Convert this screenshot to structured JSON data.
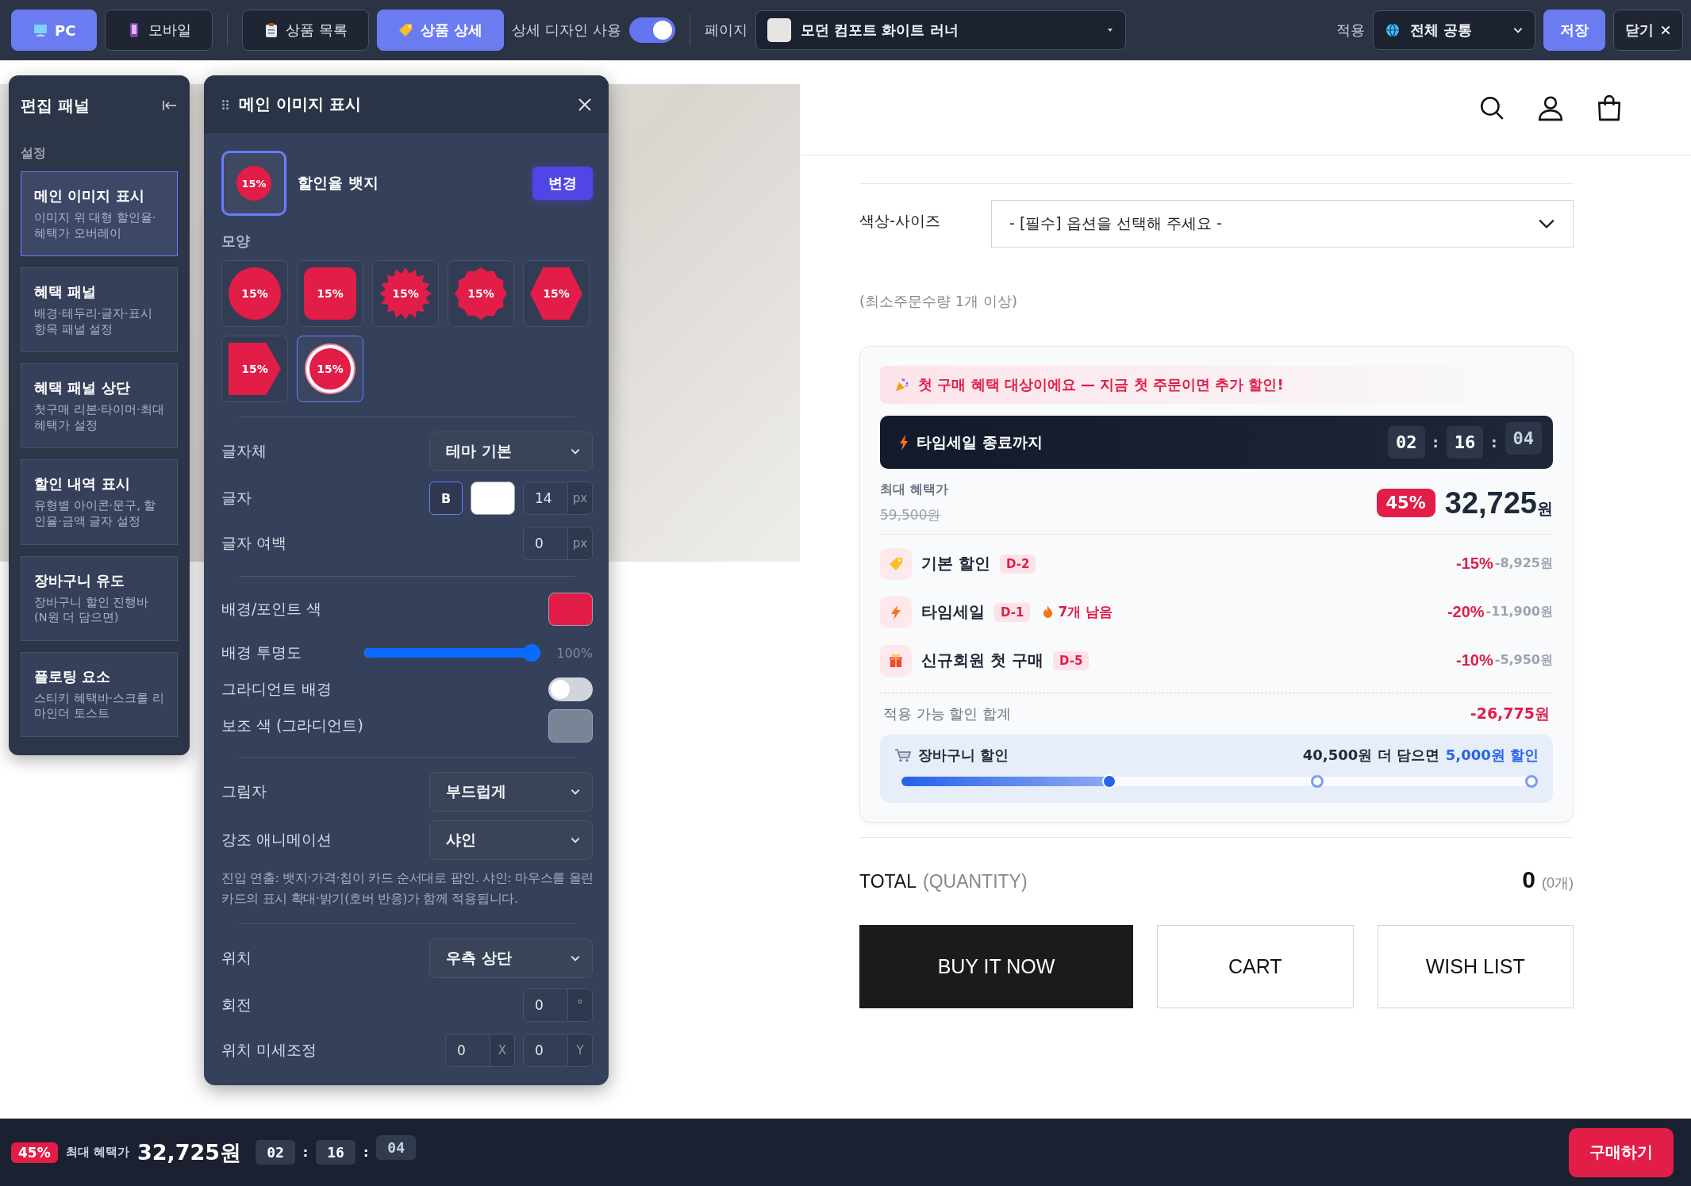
{
  "toolbar": {
    "device_tabs": [
      {
        "kind": "monitor",
        "label": "PC",
        "selected": true
      },
      {
        "kind": "phone",
        "label": "모바일",
        "selected": false
      }
    ],
    "page_tabs": [
      {
        "kind": "clipboard",
        "label": "상품 목록",
        "selected": false
      },
      {
        "kind": "tag",
        "label": "상품 상세",
        "selected": true
      }
    ],
    "detail_design": {
      "label": "상세 디자인 사용",
      "on": true
    },
    "page": {
      "label": "페이지",
      "value": "모던 컴포트 화이트 러너"
    },
    "apply": {
      "label": "적용",
      "value": "전체 공통"
    },
    "save": "저장",
    "close": "닫기"
  },
  "edit_panel": {
    "title": "편집 패널",
    "section": "설정",
    "items": [
      {
        "title": "메인 이미지 표시",
        "desc": "이미지 위 대형 할인율·혜택가 오버레이",
        "selected": true
      },
      {
        "title": "혜택 패널",
        "desc": "배경·테두리·글자·표시 항목 패널 설정",
        "selected": false
      },
      {
        "title": "혜택 패널 상단",
        "desc": "첫구매 리본·타이머·최대 혜택가 설정",
        "selected": false
      },
      {
        "title": "할인 내역 표시",
        "desc": "유형별 아이콘·문구, 할인율·금액 글자 설정",
        "selected": false
      },
      {
        "title": "장바구니 유도",
        "desc": "장바구니 할인 진행바 (N원 더 담으면)",
        "selected": false
      },
      {
        "title": "플로팅 요소",
        "desc": "스티키 혜택바·스크롤 리마인더 토스트",
        "selected": false
      }
    ]
  },
  "detail_panel": {
    "title": "메인 이미지 표시",
    "current": {
      "label": "할인율 뱃지",
      "badge": "15%",
      "button": "변경"
    },
    "shape_label": "모양",
    "shapes": [
      {
        "kind": "circle",
        "label": "15%",
        "selected": false
      },
      {
        "kind": "rounded",
        "label": "15%",
        "selected": false
      },
      {
        "kind": "starburst",
        "label": "15%",
        "selected": false
      },
      {
        "kind": "seal",
        "label": "15%",
        "selected": false
      },
      {
        "kind": "hexagon",
        "label": "15%",
        "selected": false
      },
      {
        "kind": "arrow",
        "label": "15%",
        "selected": false
      },
      {
        "kind": "ring",
        "label": "15%",
        "selected": true
      }
    ],
    "font": {
      "label": "글자체",
      "value": "테마 기본"
    },
    "text_style": {
      "label": "글자",
      "bold": true,
      "bold_label": "B",
      "color": "#ffffff",
      "size": "14",
      "unit": "px"
    },
    "letter_spacing": {
      "label": "글자 여백",
      "value": "0",
      "unit": "px"
    },
    "bg_color": {
      "label": "배경/포인트 색",
      "color": "#e11d48"
    },
    "opacity": {
      "label": "배경 투명도",
      "level": 1,
      "reading": "100%"
    },
    "gradient": {
      "label": "그라디언트 배경",
      "on": false
    },
    "secondary_color": {
      "label": "보조 색 (그라디언트)",
      "color": "#7b8396"
    },
    "shadow": {
      "label": "그림자",
      "value": "부드럽게"
    },
    "animation": {
      "label": "강조 애니메이션",
      "value": "샤인"
    },
    "hint": "진입 연출: 뱃지·가격·칩이 카드 순서대로 팝인. 샤인: 마우스를 올린 카드의 표시 확대·밝기(호버 반응)가 함께 적용됩니다.",
    "position": {
      "label": "위치",
      "value": "우측 상단"
    },
    "rotation": {
      "label": "회전",
      "value": "0",
      "unit": "°"
    },
    "offset": {
      "label": "위치 미세조정",
      "x": {
        "value": "0",
        "unit": "X"
      },
      "y": {
        "value": "0",
        "unit": "Y"
      }
    }
  },
  "product": {
    "option": {
      "label": "색상-사이즈",
      "value": "- [필수] 옵션을 선택해 주세요 -"
    },
    "min_qty": "(최소주문수량 1개 이상)",
    "benefit": {
      "ribbon": "첫 구매 혜택 대상이에요 — 지금 첫 주문이면 추가 할인!",
      "timer": {
        "label": "타임세일 종료까지",
        "units": [
          "02",
          "16",
          "04"
        ],
        "separators": [
          ":",
          ":"
        ]
      },
      "max_label": "최대 혜택가",
      "original_price": "59,500원",
      "rate": "45%",
      "price": "32,725",
      "currency": "원",
      "discounts": [
        {
          "kind": "tag",
          "name": "기본 할인",
          "dday": "D-2",
          "percent": "-15%",
          "amount": "-8,925원"
        },
        {
          "kind": "bolt",
          "name": "타임세일",
          "dday": "D-1",
          "stock": "7개 남음",
          "percent": "-20%",
          "amount": "-11,900원"
        },
        {
          "kind": "gift",
          "name": "신규회원 첫 구매",
          "dday": "D-5",
          "percent": "-10%",
          "amount": "-5,950원"
        }
      ],
      "total_label": "적용 가능 할인 합계",
      "total": "-26,775원",
      "cart": {
        "label": "장바구니 할인",
        "remaining": "40,500원 더 담으면",
        "reward": "5,000원 할인",
        "level": 0.33
      }
    },
    "total": {
      "label": "TOTAL",
      "sub": "(QUANTITY)",
      "value": "0",
      "qty": "(0개)"
    },
    "buttons": [
      {
        "kind": "primary",
        "label": "BUY IT NOW"
      },
      {
        "kind": "outline",
        "label": "CART"
      },
      {
        "kind": "outline",
        "label": "WISH LIST"
      }
    ]
  },
  "sticky_bar": {
    "rate": "45%",
    "label": "최대 혜택가",
    "price": "32,725원",
    "units": [
      "02",
      "16",
      "04"
    ],
    "separators": [
      ":",
      ":"
    ],
    "button": "구매하기"
  }
}
